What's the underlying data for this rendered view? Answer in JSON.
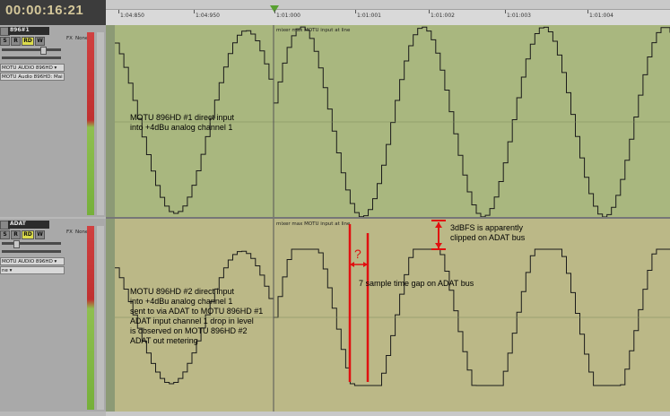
{
  "counter": "00:00:16:21",
  "ruler": {
    "ticks": [
      "1:04:850",
      "1:04:950",
      "1:01:000",
      "1:01:001",
      "1:01:002",
      "1:01:003",
      "1:01:004"
    ]
  },
  "tracks": [
    {
      "name": "896#1",
      "buttons": [
        "S",
        "R",
        "RD",
        "W"
      ],
      "input": "MOTU AUDIO 896HD ▾",
      "output": "MOTU Audio 896HD: Mai ▾",
      "fx_label": "FX",
      "none_label": "None",
      "lane_label": "mixer max MOTU input at line",
      "annotation": "MOTU 896HD #1 direct input\ninto +4dBu analog channel 1"
    },
    {
      "name": "ADAT",
      "buttons": [
        "S",
        "R",
        "RD",
        "W"
      ],
      "input": "MOTU AUDIO 896HD ▾",
      "output": "ne ▾",
      "fx_label": "FX",
      "none_label": "None",
      "lane_label": "mixer max MOTU input at line",
      "annotation": "MOTU 896HD #2 direct input\ninto +4dBu analog channel 1\nsent to via ADAT to MOTU 896HD #1\nADAT input channel 1 drop in level\nis observed on MOTU 896HD #2\nADAT out metering"
    }
  ],
  "annotations": {
    "clip_note": "3dBFS is apparently\nclipped on ADAT bus",
    "gap_note": "7 sample time gap on ADAT bus",
    "question": "?"
  },
  "colors": {
    "lane1_bg": "#a9b77f",
    "lane2_bg": "#bbb887",
    "annotation_red": "#e01010",
    "wave": "#1a1a1a"
  }
}
